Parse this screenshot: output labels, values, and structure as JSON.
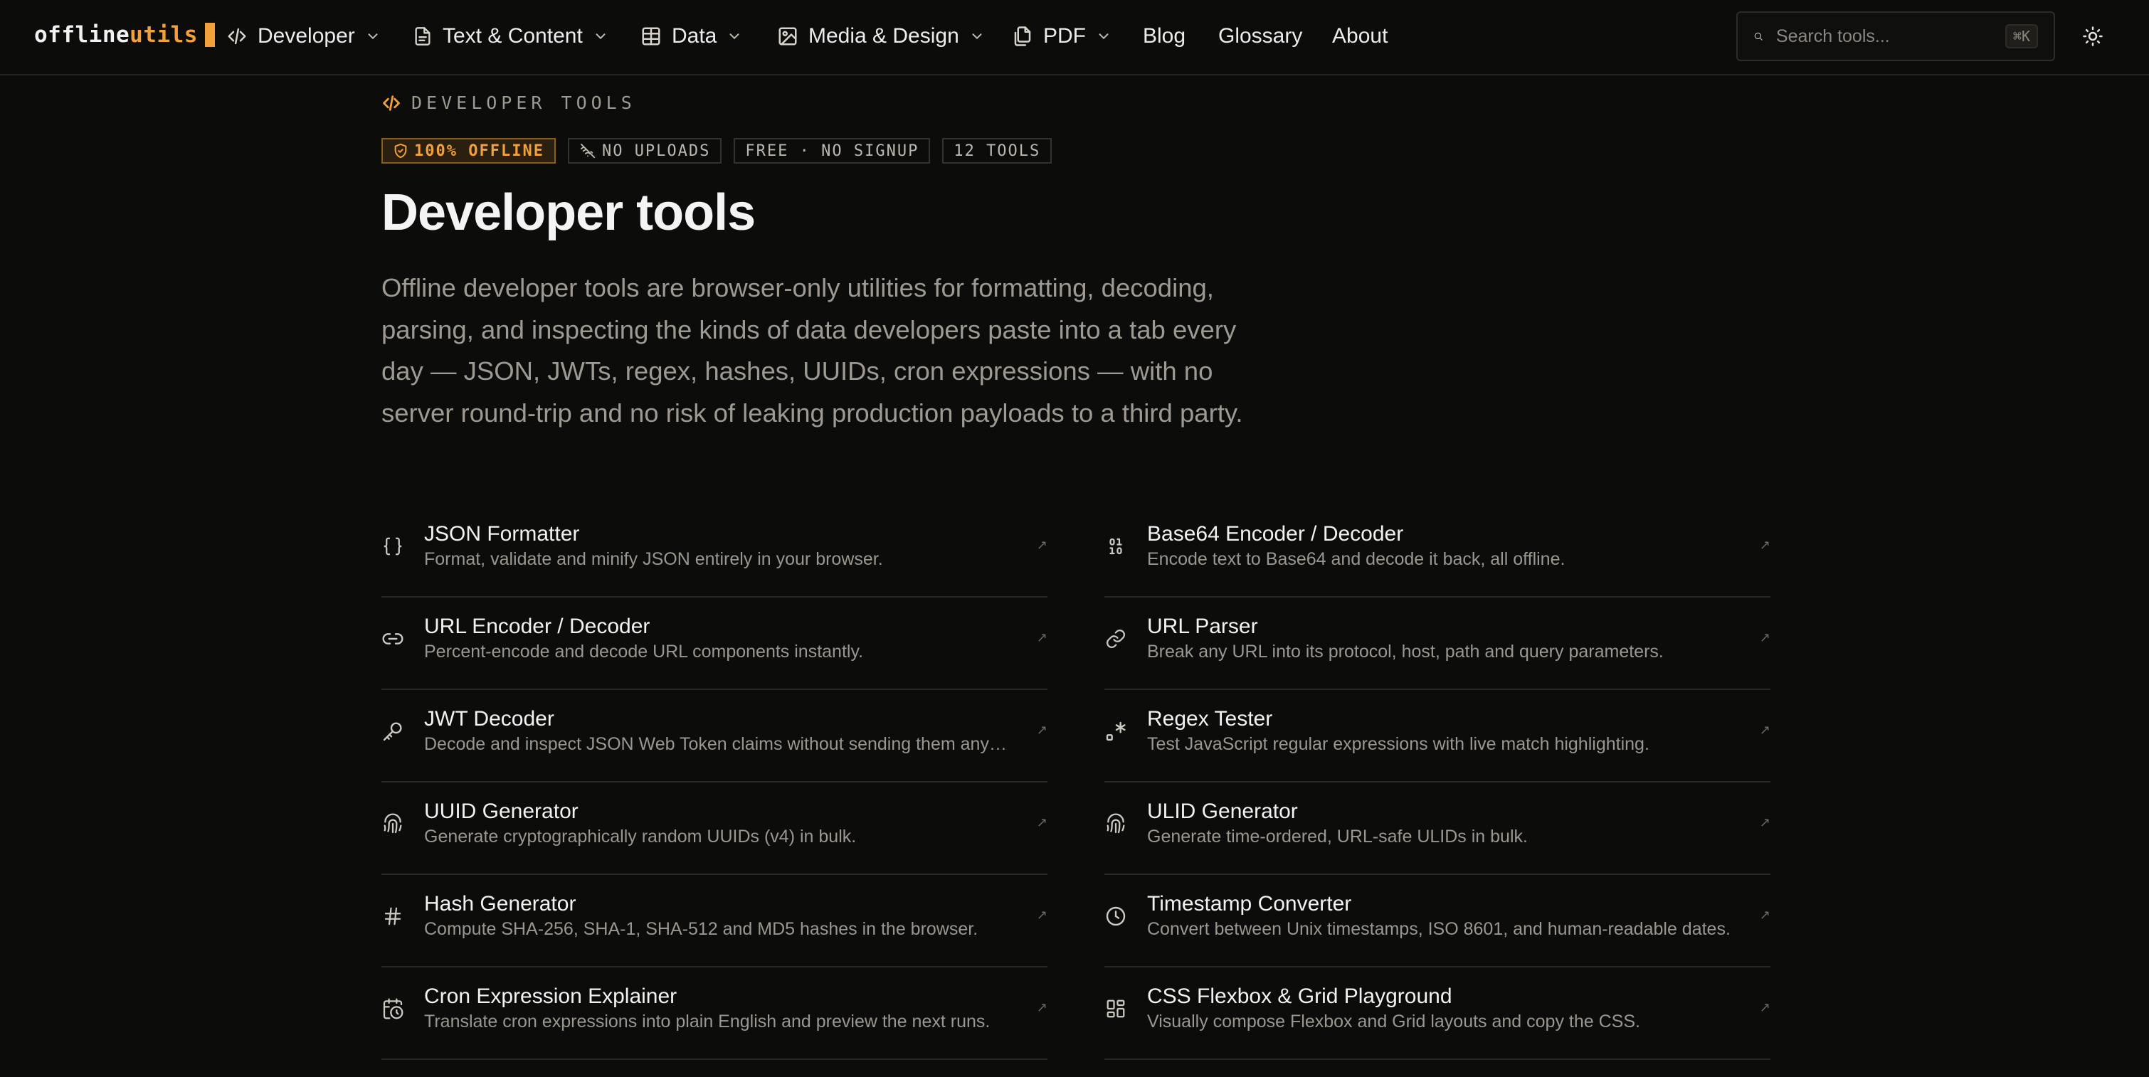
{
  "logo": {
    "part1": "offline",
    "part2": "utils"
  },
  "nav": [
    {
      "label": "Developer",
      "icon": "code-icon"
    },
    {
      "label": "Text & Content",
      "icon": "file-text-icon"
    },
    {
      "label": "Data",
      "icon": "table-icon"
    },
    {
      "label": "Media & Design",
      "icon": "image-icon"
    },
    {
      "label": "PDF",
      "icon": "copy-file-icon"
    }
  ],
  "links": [
    "Blog",
    "Glossary",
    "About"
  ],
  "search": {
    "placeholder": "Search tools...",
    "shortcut": "⌘K"
  },
  "hero": {
    "eyebrow": "DEVELOPER TOOLS",
    "badges": [
      "100% OFFLINE",
      "NO UPLOADS",
      "FREE · NO SIGNUP",
      "12 TOOLS"
    ],
    "title": "Developer tools",
    "description": "Offline developer tools are browser-only utilities for formatting, decoding, parsing, and inspecting the kinds of data developers paste into a tab every day — JSON, JWTs, regex, hashes, UUIDs, cron expressions — with no server round-trip and no risk of leaking production payloads to a third party."
  },
  "colors": {
    "accent": "#f2a03a",
    "background": "#0c0c0b"
  },
  "tools_left": [
    {
      "name": "JSON Formatter",
      "desc": "Format, validate and minify JSON entirely in your browser.",
      "icon": "braces-icon"
    },
    {
      "name": "URL Encoder / Decoder",
      "desc": "Percent-encode and decode URL components instantly.",
      "icon": "link-icon"
    },
    {
      "name": "JWT Decoder",
      "desc": "Decode and inspect JSON Web Token claims without sending them anywhe...",
      "icon": "key-icon"
    },
    {
      "name": "UUID Generator",
      "desc": "Generate cryptographically random UUIDs (v4) in bulk.",
      "icon": "fingerprint-icon"
    },
    {
      "name": "Hash Generator",
      "desc": "Compute SHA-256, SHA-1, SHA-512 and MD5 hashes in the browser.",
      "icon": "hash-icon"
    },
    {
      "name": "Cron Expression Explainer",
      "desc": "Translate cron expressions into plain English and preview the next runs.",
      "icon": "calendar-clock-icon"
    }
  ],
  "tools_right": [
    {
      "name": "Base64 Encoder / Decoder",
      "desc": "Encode text to Base64 and decode it back, all offline.",
      "icon": "binary-icon"
    },
    {
      "name": "URL Parser",
      "desc": "Break any URL into its protocol, host, path and query parameters.",
      "icon": "link-icon"
    },
    {
      "name": "Regex Tester",
      "desc": "Test JavaScript regular expressions with live match highlighting.",
      "icon": "regex-icon"
    },
    {
      "name": "ULID Generator",
      "desc": "Generate time-ordered, URL-safe ULIDs in bulk.",
      "icon": "fingerprint-icon"
    },
    {
      "name": "Timestamp Converter",
      "desc": "Convert between Unix timestamps, ISO 8601, and human-readable dates.",
      "icon": "clock-icon"
    },
    {
      "name": "CSS Flexbox & Grid Playground",
      "desc": "Visually compose Flexbox and Grid layouts and copy the CSS.",
      "icon": "layout-grid-icon"
    }
  ]
}
